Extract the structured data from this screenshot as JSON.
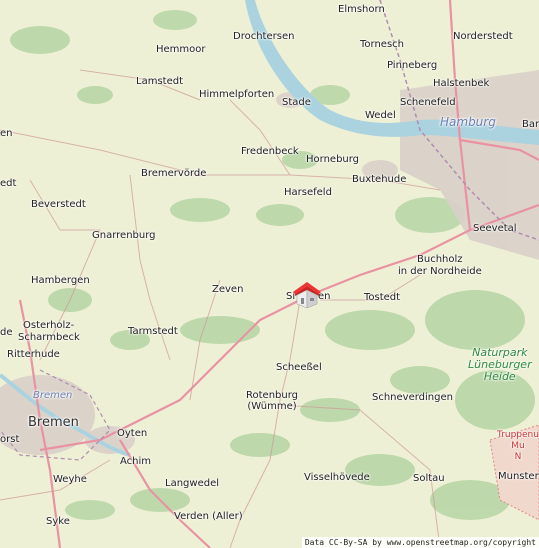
{
  "map": {
    "places": {
      "elmshorn": "Elmshorn",
      "hemmoor": "Hemmoor",
      "drochtersen": "Drochtersen",
      "tornesch": "Tornesch",
      "norderstedt": "Norderstedt",
      "lamstedt": "Lamstedt",
      "pinneberg": "Pinneberg",
      "halstenbek": "Halstenbek",
      "himmelpforten": "Himmelpforten",
      "stade": "Stade",
      "schenefeld": "Schenefeld",
      "wedel": "Wedel",
      "hamburg": "Hamburg",
      "bar": "Bar",
      "en": "en",
      "fredenbeck": "Fredenbeck",
      "horneburg": "Horneburg",
      "bremervorde": "Bremervörde",
      "buxtehude": "Buxtehude",
      "edt": "edt",
      "harsefeld": "Harsefeld",
      "beverstedt": "Beverstedt",
      "seevetal": "Seevetal",
      "gnarrenburg": "Gnarrenburg",
      "buchholz": "Buchholz",
      "in_der_nordheide": "in der Nordheide",
      "hambergen": "Hambergen",
      "zeven": "Zeven",
      "sittensen_s": "Si",
      "sittensen_en": "en",
      "tostedt": "Tostedt",
      "osterholz1": "Osterholz-",
      "osterholz2": "Scharmbeck",
      "de": "de",
      "tarmstedt": "Tarmstedt",
      "ritterhude": "Ritterhude",
      "scheessel": "Scheeßel",
      "naturpark1": "Naturpark",
      "naturpark2": "Lüneburger",
      "naturpark3": "Heide",
      "bremen_water": "Bremen",
      "rotenburg1": "Rotenburg",
      "rotenburg2": "(Wümme)",
      "schneverdingen": "Schneverdingen",
      "bremen": "Bremen",
      "orst": "orst",
      "oyten": "Oyten",
      "truppen1": "Truppenu",
      "truppen2": "Mu",
      "truppen3": "N",
      "achim": "Achim",
      "weyhe": "Weyhe",
      "langwedel": "Langwedel",
      "visselhovede": "Visselhövede",
      "soltau": "Soltau",
      "munster": "Munster",
      "syke": "Syke",
      "verden": "Verden (Aller)"
    },
    "attribution": "Data CC-By-SA by www.openstreetmap.org/copyright",
    "marker_icon": "house-marker-icon",
    "colors": {
      "land": "#eef0d5",
      "forest": "#add19e",
      "water": "#aad3df",
      "urban": "#d9d0c9",
      "motorway": "#e892a2",
      "primary": "#fcd6a4"
    }
  }
}
